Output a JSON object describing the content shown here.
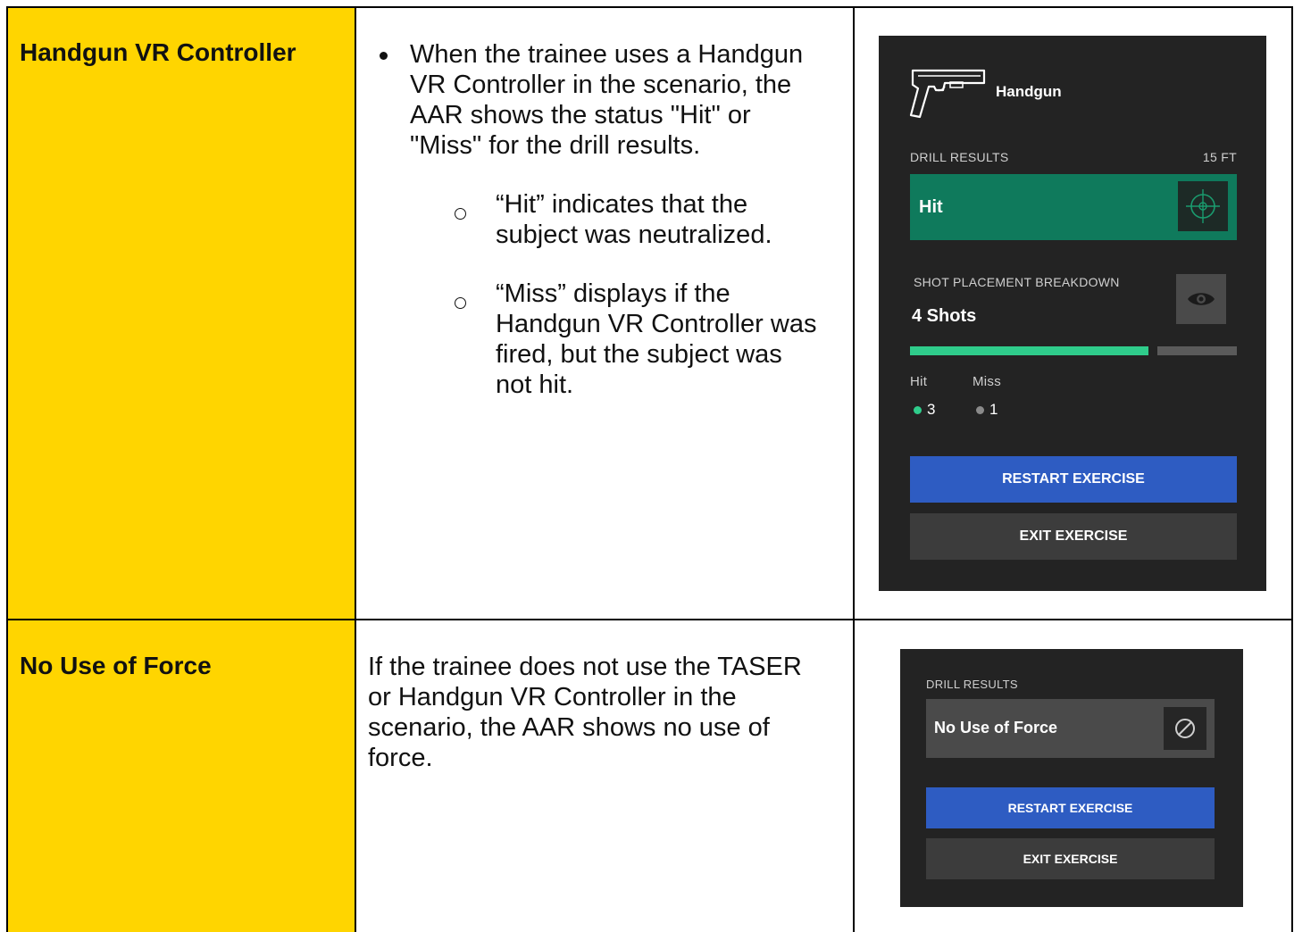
{
  "rows": [
    {
      "label": "Handgun VR Controller",
      "bullet_text": "When the trainee uses a Handgun VR Controller in the scenario, the AAR shows the status \"Hit\" or \"Miss\" for the drill results.",
      "bullet_lines": [
        "When the trainee uses a Handgun",
        "VR Controller in the scenario, the",
        "AAR shows the status \"Hit\" or",
        "\"Miss\" for the drill results."
      ],
      "sub_items": [
        {
          "lines": [
            "“Hit” indicates that the",
            "subject was neutralized."
          ]
        },
        {
          "lines": [
            "“Miss” displays if the",
            "Handgun VR Controller was",
            "fired, but the subject was",
            "not hit."
          ]
        }
      ]
    },
    {
      "label": "No Use of Force",
      "lines": [
        "If the trainee does not use the TASER",
        "or Handgun VR Controller in the",
        "scenario, the AAR shows no use of",
        "force."
      ]
    }
  ],
  "panel1": {
    "weapon": "Handgun",
    "drill_results": "DRILL RESULTS",
    "distance": "15 FT",
    "status": "Hit",
    "status_icon": "crosshair-icon",
    "breakdown_label": "SHOT PLACEMENT BREAKDOWN",
    "shots": "4 Shots",
    "view_icon": "eye-icon",
    "hit_fraction": 0.75,
    "legend": [
      {
        "label": "Hit",
        "value": "3",
        "color": "#2FCC8B"
      },
      {
        "label": "Miss",
        "value": "1",
        "color": "#8a8a8a"
      }
    ],
    "restart": "RESTART EXERCISE",
    "exit": "EXIT EXERCISE"
  },
  "panel2": {
    "drill_results": "DRILL RESULTS",
    "status": "No Use of Force",
    "status_icon": "prohibited-icon",
    "restart": "RESTART EXERCISE",
    "exit": "EXIT EXERCISE"
  },
  "colors": {
    "yellow": "#FFD500",
    "hit_green": "#0F7A5C",
    "bar_green": "#2FCC8B",
    "button_blue": "#2E5CC2",
    "panel_dark": "#232323"
  }
}
